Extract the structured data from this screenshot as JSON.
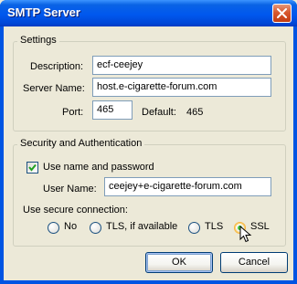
{
  "window": {
    "title": "SMTP Server"
  },
  "settings": {
    "legend": "Settings",
    "description": {
      "label": "Description:",
      "value": "ecf-ceejey"
    },
    "server_name": {
      "label": "Server Name:",
      "value": "host.e-cigarette-forum.com"
    },
    "port": {
      "label": "Port:",
      "value": "465",
      "default_label": "Default:",
      "default_value": "465"
    }
  },
  "security": {
    "legend": "Security and Authentication",
    "use_name_password": {
      "label": "Use name and password",
      "checked": true
    },
    "user_name": {
      "label": "User Name:",
      "value": "ceejey+e-cigarette-forum.com"
    },
    "secure_connection_label": "Use secure connection:",
    "options": [
      {
        "label": "No",
        "selected": false
      },
      {
        "label": "TLS, if available",
        "selected": false
      },
      {
        "label": "TLS",
        "selected": false
      },
      {
        "label": "SSL",
        "selected": true
      }
    ]
  },
  "buttons": {
    "ok": "OK",
    "cancel": "Cancel"
  }
}
